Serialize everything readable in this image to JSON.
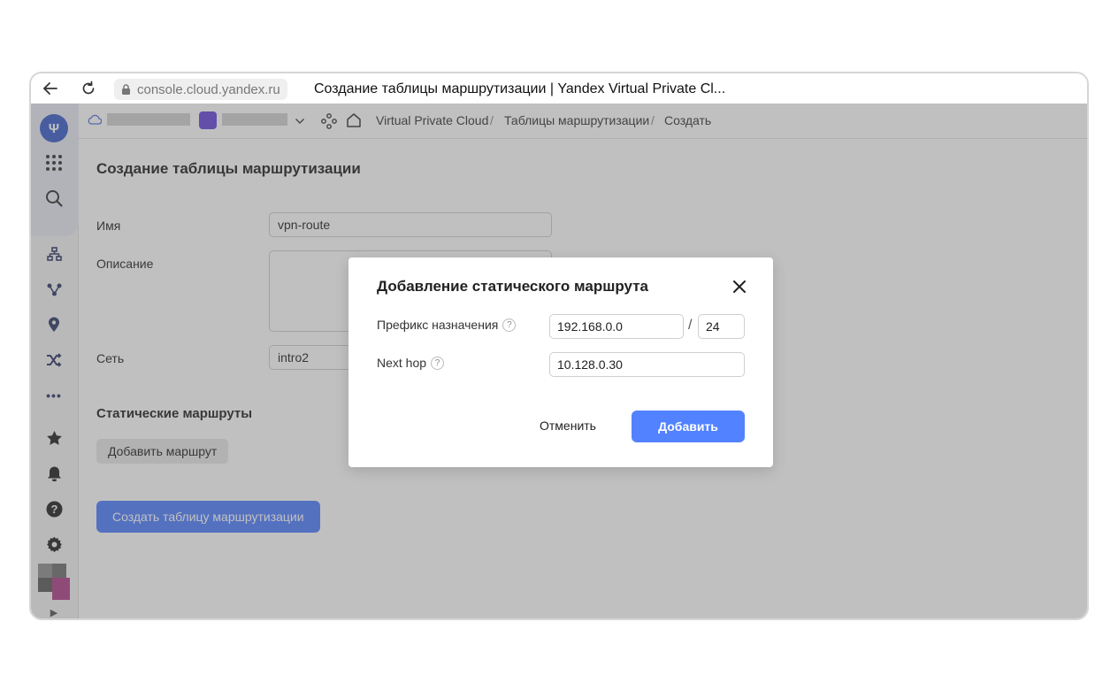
{
  "browser": {
    "url": "console.cloud.yandex.ru",
    "tab_title": "Создание таблицы маршрутизации | Yandex Virtual Private Cl..."
  },
  "sidebar": {
    "logo_glyph": "Ψ",
    "icons": [
      "services-grid-icon",
      "search-icon",
      "network-icon",
      "route-icon",
      "location-pin-icon",
      "shuffle-icon",
      "more-dots-icon",
      "star-icon",
      "bell-icon",
      "help-icon",
      "settings-icon",
      "expand-arrow-icon"
    ],
    "more_label": "•••",
    "expand_label": "▶"
  },
  "breadcrumbs": [
    "Virtual Private Cloud",
    "Таблицы маршрутизации",
    "Создать"
  ],
  "breadcrumb_sep": "/",
  "form": {
    "title": "Создание таблицы маршрутизации",
    "name_label": "Имя",
    "name_value": "vpn-route",
    "description_label": "Описание",
    "description_value": "",
    "network_label": "Сеть",
    "network_value": "intro2",
    "static_routes_title": "Статические маршруты",
    "add_route_button": "Добавить маршрут",
    "create_button": "Создать таблицу маршрутизации"
  },
  "modal": {
    "title": "Добавление статического маршрута",
    "prefix_label": "Префикс назначения",
    "prefix_value": "192.168.0.0",
    "prefix_separator": "/",
    "prefix_mask": "24",
    "next_hop_label": "Next hop",
    "next_hop_value": "10.128.0.30",
    "help_glyph": "?",
    "cancel_button": "Отменить",
    "add_button": "Добавить"
  },
  "colors": {
    "accent_blue": "#5282ff",
    "logo_blue": "#3c5ecb",
    "project_purple": "#6845d9",
    "overlay": "rgba(92,92,92,0.39)"
  }
}
